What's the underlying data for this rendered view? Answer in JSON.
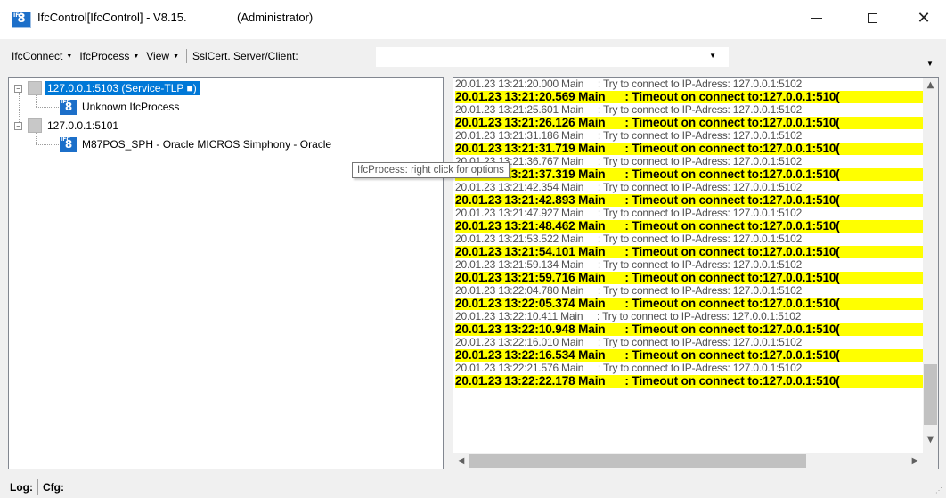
{
  "window": {
    "title": "IfcControl[IfcControl] - V8.15.",
    "admin": "(Administrator)",
    "icon_text": "8",
    "icon_sub": "IFC"
  },
  "menu": {
    "items": [
      {
        "label": "IfcConnect"
      },
      {
        "label": "IfcProcess"
      },
      {
        "label": "View"
      }
    ],
    "ssl_label": "SslCert. Server/Client:",
    "ssl_value": ""
  },
  "tree": {
    "nodes": [
      {
        "label": "127.0.0.1:5103 (Service-TLP ■)",
        "expander": "−",
        "selected": true
      },
      {
        "label": "Unknown IfcProcess"
      },
      {
        "label": "127.0.0.1:5101",
        "expander": "−"
      },
      {
        "label": "M87POS_SPH - Oracle MICROS Simphony - Oracle"
      }
    ]
  },
  "tooltip": "IfcProcess: right click for options",
  "log": {
    "lines": [
      {
        "type": "info",
        "time": "20.01.23 13:21:20.000 Main",
        "msg": "     : Try to connect to IP-Adress: 127.0.0.1:5102"
      },
      {
        "type": "warn",
        "time": "20.01.23 13:21:20.569 Main",
        "msg": "      : Timeout on connect to:127.0.0.1:510("
      },
      {
        "type": "info",
        "time": "20.01.23 13:21:25.601 Main",
        "msg": "     : Try to connect to IP-Adress: 127.0.0.1:5102"
      },
      {
        "type": "warn",
        "time": "20.01.23 13:21:26.126 Main",
        "msg": "      : Timeout on connect to:127.0.0.1:510("
      },
      {
        "type": "info",
        "time": "20.01.23 13:21:31.186 Main",
        "msg": "     : Try to connect to IP-Adress: 127.0.0.1:5102"
      },
      {
        "type": "warn",
        "time": "20.01.23 13:21:31.719 Main",
        "msg": "      : Timeout on connect to:127.0.0.1:510("
      },
      {
        "type": "info",
        "time": "20.01.23 13:21:36.767 Main",
        "msg": "     : Try to connect to IP-Adress: 127.0.0.1:5102"
      },
      {
        "type": "warn",
        "time": "20.01.23 13:21:37.319 Main",
        "msg": "      : Timeout on connect to:127.0.0.1:510("
      },
      {
        "type": "info",
        "time": "20.01.23 13:21:42.354 Main",
        "msg": "     : Try to connect to IP-Adress: 127.0.0.1:5102"
      },
      {
        "type": "warn",
        "time": "20.01.23 13:21:42.893 Main",
        "msg": "      : Timeout on connect to:127.0.0.1:510("
      },
      {
        "type": "info",
        "time": "20.01.23 13:21:47.927 Main",
        "msg": "     : Try to connect to IP-Adress: 127.0.0.1:5102"
      },
      {
        "type": "warn",
        "time": "20.01.23 13:21:48.462 Main",
        "msg": "      : Timeout on connect to:127.0.0.1:510("
      },
      {
        "type": "info",
        "time": "20.01.23 13:21:53.522 Main",
        "msg": "     : Try to connect to IP-Adress: 127.0.0.1:5102"
      },
      {
        "type": "warn",
        "time": "20.01.23 13:21:54.101 Main",
        "msg": "      : Timeout on connect to:127.0.0.1:510("
      },
      {
        "type": "info",
        "time": "20.01.23 13:21:59.134 Main",
        "msg": "     : Try to connect to IP-Adress: 127.0.0.1:5102"
      },
      {
        "type": "warn",
        "time": "20.01.23 13:21:59.716 Main",
        "msg": "      : Timeout on connect to:127.0.0.1:510("
      },
      {
        "type": "info",
        "time": "20.01.23 13:22:04.780 Main",
        "msg": "     : Try to connect to IP-Adress: 127.0.0.1:5102"
      },
      {
        "type": "warn",
        "time": "20.01.23 13:22:05.374 Main",
        "msg": "      : Timeout on connect to:127.0.0.1:510("
      },
      {
        "type": "info",
        "time": "20.01.23 13:22:10.411 Main",
        "msg": "     : Try to connect to IP-Adress: 127.0.0.1:5102"
      },
      {
        "type": "warn",
        "time": "20.01.23 13:22:10.948 Main",
        "msg": "      : Timeout on connect to:127.0.0.1:510("
      },
      {
        "type": "info",
        "time": "20.01.23 13:22:16.010 Main",
        "msg": "     : Try to connect to IP-Adress: 127.0.0.1:5102"
      },
      {
        "type": "warn",
        "time": "20.01.23 13:22:16.534 Main",
        "msg": "      : Timeout on connect to:127.0.0.1:510("
      },
      {
        "type": "info",
        "time": "20.01.23 13:22:21.576 Main",
        "msg": "     : Try to connect to IP-Adress: 127.0.0.1:5102"
      },
      {
        "type": "warn",
        "time": "20.01.23 13:22:22.178 Main",
        "msg": "      : Timeout on connect to:127.0.0.1:510("
      }
    ]
  },
  "status": {
    "log_label": "Log:",
    "cfg_label": "Cfg:"
  },
  "colors": {
    "selection": "#0078d7",
    "warn_highlight": "#ffff00",
    "app_icon": "#1c6fc9"
  }
}
